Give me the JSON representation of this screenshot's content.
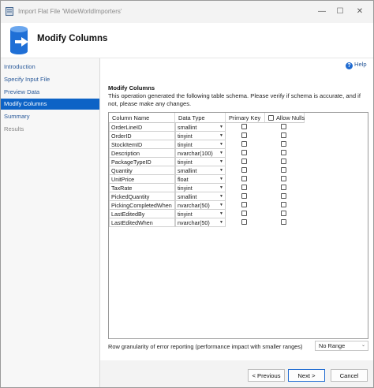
{
  "window": {
    "title": "Import Flat File 'WideWorldImporters'",
    "controls": {
      "minimize": "—",
      "maximize": "☐",
      "close": "✕"
    }
  },
  "header": {
    "title": "Modify Columns",
    "icon": "database-import-icon"
  },
  "sidebar": {
    "items": [
      {
        "label": "Introduction",
        "state": "link"
      },
      {
        "label": "Specify Input File",
        "state": "link"
      },
      {
        "label": "Preview Data",
        "state": "link"
      },
      {
        "label": "Modify Columns",
        "state": "active"
      },
      {
        "label": "Summary",
        "state": "link"
      },
      {
        "label": "Results",
        "state": "disabled"
      }
    ]
  },
  "help": {
    "label": "Help",
    "icon": "?"
  },
  "section": {
    "title": "Modify Columns",
    "description": "This operation generated the following table schema. Please verify if schema is accurate, and if not, please make any changes."
  },
  "grid": {
    "headers": {
      "column_name": "Column Name",
      "data_type": "Data Type",
      "primary_key": "Primary Key",
      "allow_nulls": "Allow Nulls"
    },
    "rows": [
      {
        "name": "OrderLineID",
        "type": "smallint",
        "pk": false,
        "nulls": false
      },
      {
        "name": "OrderID",
        "type": "tinyint",
        "pk": false,
        "nulls": false
      },
      {
        "name": "StockItemID",
        "type": "tinyint",
        "pk": false,
        "nulls": false
      },
      {
        "name": "Description",
        "type": "nvarchar(100)",
        "pk": false,
        "nulls": false
      },
      {
        "name": "PackageTypeID",
        "type": "tinyint",
        "pk": false,
        "nulls": false
      },
      {
        "name": "Quantity",
        "type": "smallint",
        "pk": false,
        "nulls": false
      },
      {
        "name": "UnitPrice",
        "type": "float",
        "pk": false,
        "nulls": false
      },
      {
        "name": "TaxRate",
        "type": "tinyint",
        "pk": false,
        "nulls": false
      },
      {
        "name": "PickedQuantity",
        "type": "smallint",
        "pk": false,
        "nulls": false
      },
      {
        "name": "PickingCompletedWhen",
        "type": "nvarchar(50)",
        "pk": false,
        "nulls": false
      },
      {
        "name": "LastEditedBy",
        "type": "tinyint",
        "pk": false,
        "nulls": false
      },
      {
        "name": "LastEditedWhen",
        "type": "nvarchar(50)",
        "pk": false,
        "nulls": false
      }
    ]
  },
  "granularity": {
    "label": "Row granularity of error reporting (performance impact with smaller ranges)",
    "value": "No Range"
  },
  "buttons": {
    "previous": "< Previous",
    "next": "Next >",
    "cancel": "Cancel"
  }
}
